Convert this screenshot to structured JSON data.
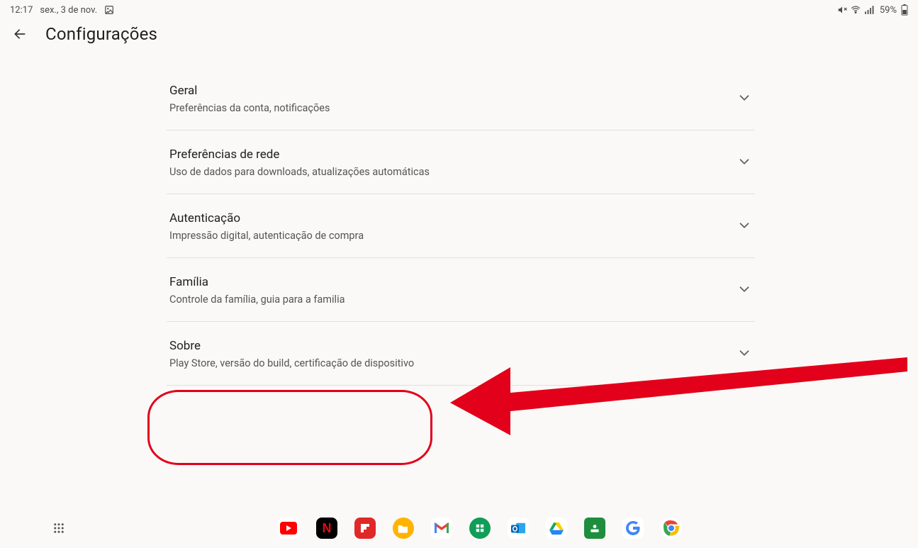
{
  "status_bar": {
    "time": "12:17",
    "date": "sex., 3 de nov.",
    "battery_text": "59%"
  },
  "header": {
    "title": "Configurações"
  },
  "settings": [
    {
      "title": "Geral",
      "subtitle": "Preferências da conta, notificações"
    },
    {
      "title": "Preferências de rede",
      "subtitle": "Uso de dados para downloads, atualizações automáticas"
    },
    {
      "title": "Autenticação",
      "subtitle": "Impressão digital, autenticação de compra"
    },
    {
      "title": "Família",
      "subtitle": "Controle da família, guia para a familia"
    },
    {
      "title": "Sobre",
      "subtitle": "Play Store, versão do build, certificação de dispositivo"
    }
  ],
  "annotation": {
    "target_index": 4,
    "color": "#e2001a"
  },
  "dock": {
    "apps": [
      {
        "name": "youtube"
      },
      {
        "name": "netflix"
      },
      {
        "name": "flipboard"
      },
      {
        "name": "files"
      },
      {
        "name": "gmail"
      },
      {
        "name": "sheets"
      },
      {
        "name": "outlook"
      },
      {
        "name": "drive"
      },
      {
        "name": "classroom"
      },
      {
        "name": "google"
      },
      {
        "name": "chrome"
      }
    ]
  }
}
